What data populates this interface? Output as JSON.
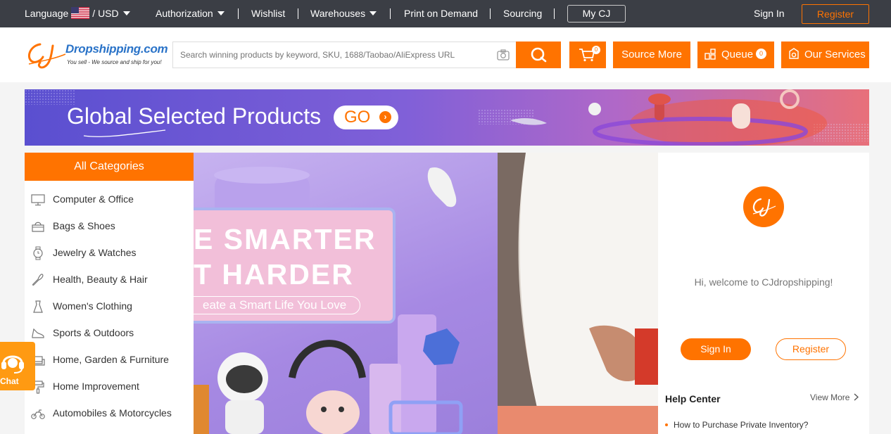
{
  "topbar": {
    "language_label": "Language",
    "currency": "/ USD",
    "authorization": "Authorization",
    "wishlist": "Wishlist",
    "warehouses": "Warehouses",
    "print_on_demand": "Print on Demand",
    "sourcing": "Sourcing",
    "my_cj": "My CJ",
    "sign_in": "Sign In",
    "register": "Register"
  },
  "header": {
    "logo_main": "Dropshipping.com",
    "logo_sub": "You sell - We source and ship for you!",
    "search_placeholder": "Search winning products by keyword, SKU, 1688/Taobao/AliExpress URL",
    "cart_count": "0",
    "source_more": "Source More",
    "queue": "Queue",
    "queue_count": "0",
    "our_services": "Our Services"
  },
  "banner": {
    "title": "Global Selected Products",
    "go": "GO"
  },
  "categories": {
    "title": "All Categories",
    "items": [
      {
        "label": "Computer & Office",
        "icon": "monitor-icon"
      },
      {
        "label": "Bags & Shoes",
        "icon": "bag-icon"
      },
      {
        "label": "Jewelry & Watches",
        "icon": "watch-icon"
      },
      {
        "label": "Health, Beauty & Hair",
        "icon": "brush-icon"
      },
      {
        "label": "Women's Clothing",
        "icon": "dress-icon"
      },
      {
        "label": "Sports & Outdoors",
        "icon": "shoe-icon"
      },
      {
        "label": "Home, Garden & Furniture",
        "icon": "sofa-icon"
      },
      {
        "label": "Home Improvement",
        "icon": "paint-roller-icon"
      },
      {
        "label": "Automobiles & Motorcycles",
        "icon": "motorcycle-icon"
      }
    ]
  },
  "hero": {
    "line1": "E SMARTER",
    "line2": "T HARDER",
    "tagline": "eate a Smart Life You Love"
  },
  "welcome": {
    "message": "Hi, welcome to CJdropshipping!",
    "sign_in": "Sign In",
    "register": "Register",
    "help_title": "Help Center",
    "view_more": "View More",
    "help_items": [
      "How to Purchase Private Inventory?"
    ]
  },
  "chat": {
    "label": "Chat"
  },
  "colors": {
    "accent": "#ff7300",
    "topbar": "#3b3e45",
    "link_blue": "#2a73c8"
  }
}
